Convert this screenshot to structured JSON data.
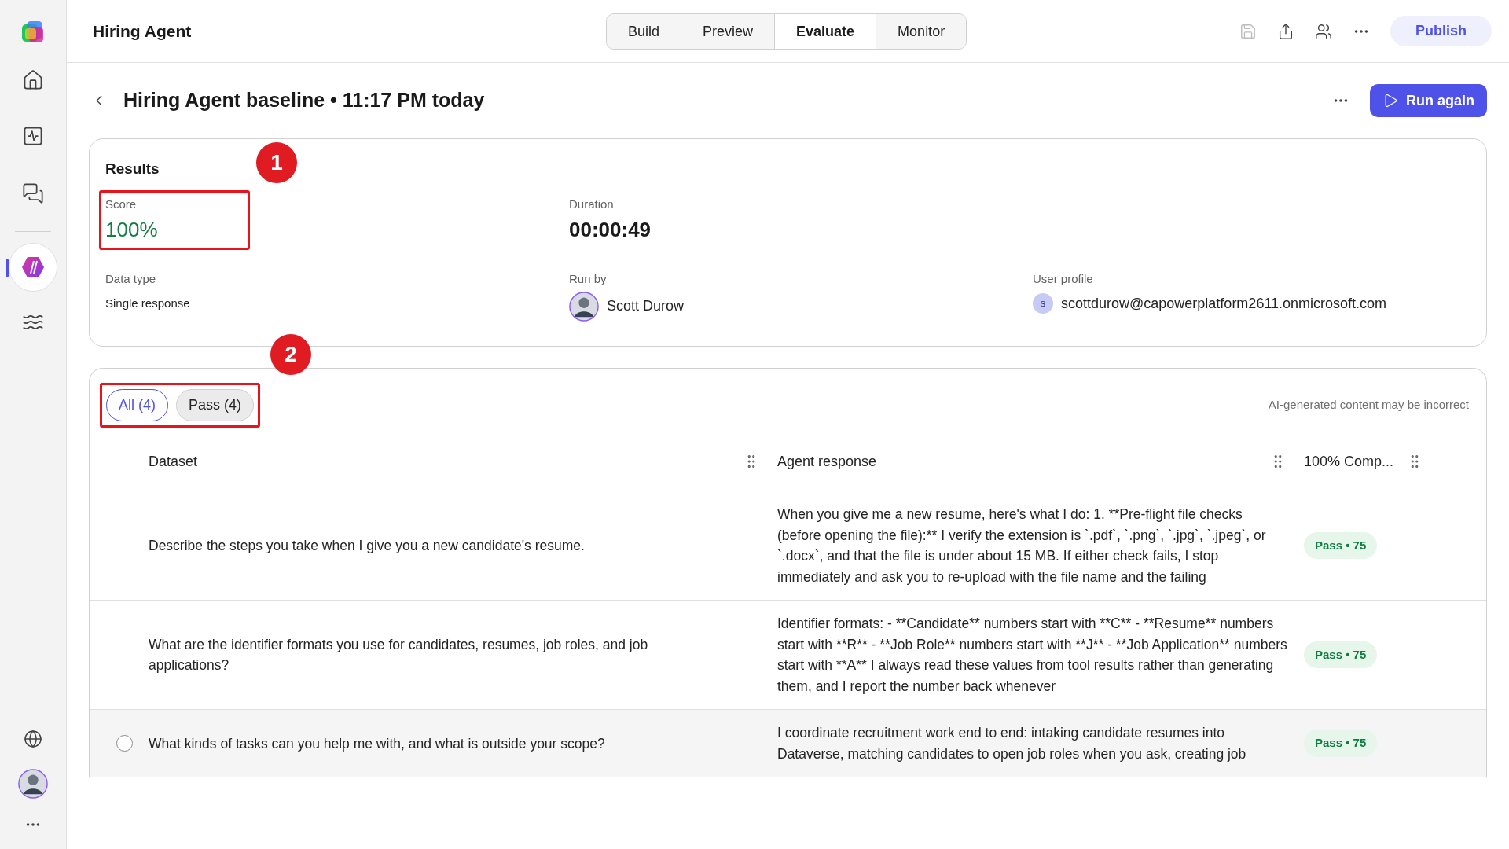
{
  "app_title": "Hiring Agent",
  "tabs": [
    {
      "label": "Build",
      "selected": false
    },
    {
      "label": "Preview",
      "selected": false
    },
    {
      "label": "Evaluate",
      "selected": true
    },
    {
      "label": "Monitor",
      "selected": false
    }
  ],
  "toolbar": {
    "save_disabled": true,
    "publish": "Publish"
  },
  "header": {
    "title": "Hiring Agent baseline • 11:17 PM today",
    "run_again": "Run again"
  },
  "annotations": [
    {
      "label": "1"
    },
    {
      "label": "2"
    }
  ],
  "results": {
    "heading": "Results",
    "fields": [
      {
        "kind": "score",
        "label": "Score",
        "value": "100%"
      },
      {
        "kind": "big",
        "label": "Duration",
        "value": "00:00:49"
      },
      {
        "kind": "plain",
        "label": "Data type",
        "value": "Single response"
      },
      {
        "kind": "person",
        "label": "Run by",
        "value": "Scott Durow"
      },
      {
        "kind": "profile",
        "label": "User profile",
        "initial": "s",
        "value": "scottdurow@capowerplatform2611.onmicrosoft.com"
      }
    ]
  },
  "filters": [
    {
      "label": "All (4)",
      "selected": true
    },
    {
      "label": "Pass (4)",
      "selected": false
    }
  ],
  "disclaimer": "AI-generated content may be incorrect",
  "table": {
    "columns": [
      "Dataset",
      "Agent response",
      "100% Comp..."
    ],
    "rows": [
      {
        "hovered": false,
        "dataset": "Describe the steps you take when I give you a new candidate's resume.",
        "response": "When you give me a new resume, here's what I do: 1. **Pre-flight file checks (before opening the file):** I verify the extension is `.pdf`, `.png`, `.jpg`, `.jpeg`, or `.docx`, and that the file is under about 15 MB. If either check fails, I stop immediately and ask you to re-upload with the file name and the failing",
        "result": "Pass • 75"
      },
      {
        "hovered": false,
        "dataset": "What are the identifier formats you use for candidates, resumes, job roles, and job applications?",
        "response": "Identifier formats: - **Candidate** numbers start with **C** - **Resume** numbers start with **R** - **Job Role** numbers start with **J** - **Job Application** numbers start with **A** I always read these values from tool results rather than generating them, and I report the number back whenever",
        "result": "Pass • 75"
      },
      {
        "hovered": true,
        "dataset": "What kinds of tasks can you help me with, and what is outside your scope?",
        "response": "I coordinate recruitment work end to end: intaking candidate resumes into Dataverse, matching candidates to open job roles when you ask, creating job",
        "result": "Pass • 75"
      }
    ]
  }
}
